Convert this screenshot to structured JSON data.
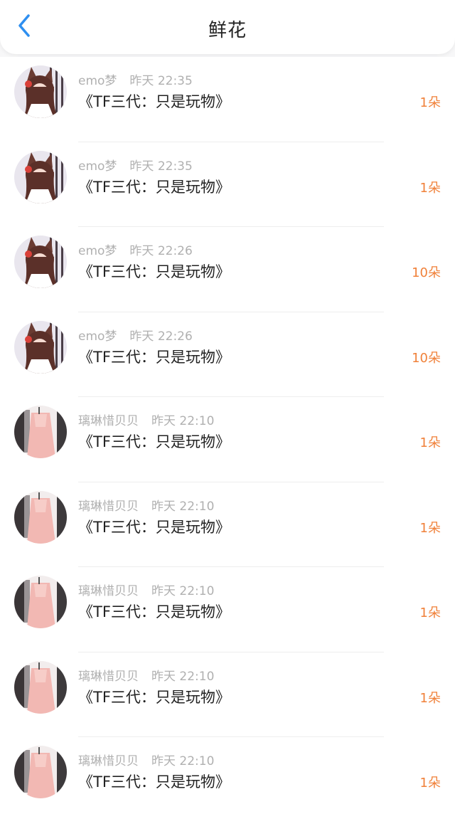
{
  "header": {
    "title": "鲜花",
    "back_icon": "chevron-left-icon",
    "accent_color": "#2e8ff0"
  },
  "colors": {
    "count": "#f0813a",
    "meta": "#b0b0b0",
    "text": "#222222"
  },
  "items": [
    {
      "user": "emo梦",
      "time": "昨天 22:35",
      "book": "《TF三代：只是玩物》",
      "count": "1朵",
      "avatar": "anime-girl-avatar"
    },
    {
      "user": "emo梦",
      "time": "昨天 22:35",
      "book": "《TF三代：只是玩物》",
      "count": "1朵",
      "avatar": "anime-girl-avatar"
    },
    {
      "user": "emo梦",
      "time": "昨天 22:26",
      "book": "《TF三代：只是玩物》",
      "count": "10朵",
      "avatar": "anime-girl-avatar"
    },
    {
      "user": "emo梦",
      "time": "昨天 22:26",
      "book": "《TF三代：只是玩物》",
      "count": "10朵",
      "avatar": "anime-girl-avatar"
    },
    {
      "user": "璃琳惜贝贝",
      "time": "昨天 22:10",
      "book": "《TF三代：只是玩物》",
      "count": "1朵",
      "avatar": "pink-outfit-avatar"
    },
    {
      "user": "璃琳惜贝贝",
      "time": "昨天 22:10",
      "book": "《TF三代：只是玩物》",
      "count": "1朵",
      "avatar": "pink-outfit-avatar"
    },
    {
      "user": "璃琳惜贝贝",
      "time": "昨天 22:10",
      "book": "《TF三代：只是玩物》",
      "count": "1朵",
      "avatar": "pink-outfit-avatar"
    },
    {
      "user": "璃琳惜贝贝",
      "time": "昨天 22:10",
      "book": "《TF三代：只是玩物》",
      "count": "1朵",
      "avatar": "pink-outfit-avatar"
    },
    {
      "user": "璃琳惜贝贝",
      "time": "昨天 22:10",
      "book": "《TF三代：只是玩物》",
      "count": "1朵",
      "avatar": "pink-outfit-avatar"
    }
  ]
}
